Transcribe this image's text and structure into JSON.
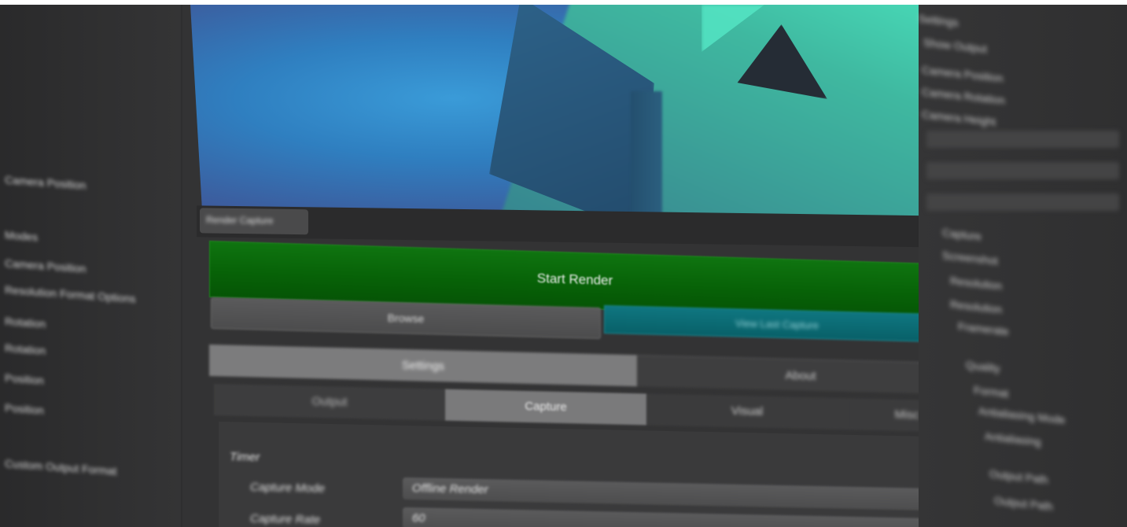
{
  "left_panel": {
    "items": [
      "Camera Position",
      "Modes",
      "Camera Position",
      "Resolution Format Options",
      "Rotation",
      "Rotation",
      "Position",
      "Position",
      "Custom Output Format"
    ]
  },
  "viewport": {
    "tab_label": "Render Capture"
  },
  "render": {
    "start_label": "Start Render",
    "browse_label": "Browse",
    "view_label": "View Last Capture"
  },
  "main_tabs": {
    "settings_label": "Settings",
    "about_label": "About"
  },
  "sub_tabs": {
    "output_label": "Output",
    "capture_label": "Capture",
    "visual_label": "Visual",
    "misc_label": "Misc"
  },
  "capture_settings": {
    "section_title": "Timer",
    "capture_mode_label": "Capture Mode",
    "capture_mode_value": "Offline Render",
    "capture_rate_label": "Capture Rate",
    "capture_rate_value": "60"
  },
  "right_panel": {
    "items": [
      "Settings",
      "Show Output",
      "Camera Position",
      "Camera Rotation",
      "Camera Height",
      "Capture",
      "Screenshot",
      "Resolution",
      "Resolution",
      "Framerate",
      "Quality",
      "Format",
      "Antialiasing Mode",
      "Antialiasing",
      "Output Path",
      "Output Path"
    ]
  },
  "colors": {
    "start_render": "#076207",
    "view_last_capture": "#086068",
    "active_tab": "#7c7c7d",
    "panel_bg": "#333334"
  }
}
